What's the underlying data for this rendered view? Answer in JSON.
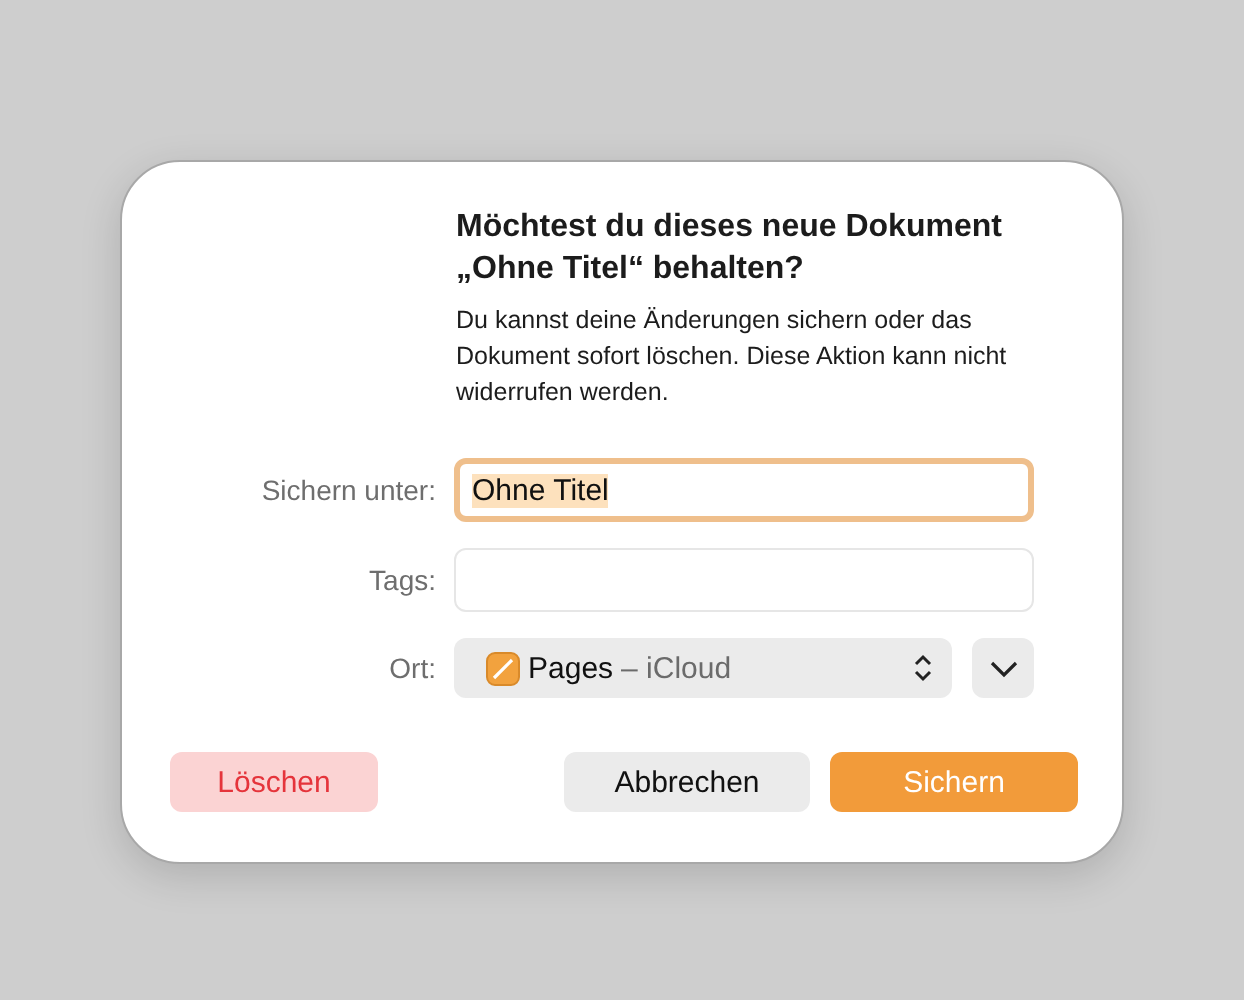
{
  "dialog": {
    "title": "Möchtest du dieses neue Dokument „Ohne Titel“ behalten?",
    "message": "Du kannst deine Änderungen sichern oder das Dokument sofort löschen. Diese Aktion kann nicht widerrufen werden.",
    "fields": [
      {
        "kind": "text",
        "label": "Sichern unter:",
        "value": "Ohne Titel",
        "focused": true,
        "selected": true
      },
      {
        "kind": "text",
        "label": "Tags:",
        "focused": false
      },
      {
        "kind": "location",
        "label": "Ort:",
        "app": "Pages",
        "place": "– iCloud",
        "expanded": false
      }
    ],
    "buttons": [
      {
        "kind": "destructive",
        "label": "Löschen"
      },
      {
        "kind": "cancel",
        "label": "Abbrechen"
      },
      {
        "kind": "primary",
        "label": "Sichern"
      }
    ]
  }
}
